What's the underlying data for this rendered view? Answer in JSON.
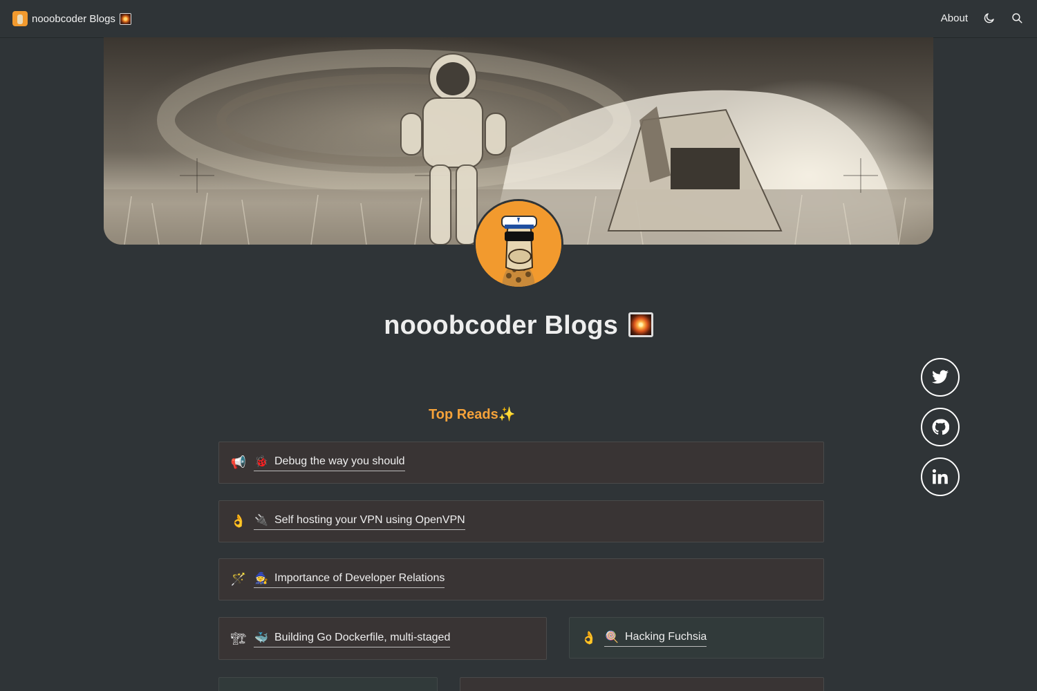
{
  "nav": {
    "brand_title": "nooobcoder Blogs",
    "about_label": "About",
    "icons": [
      "moon-icon",
      "search-icon"
    ]
  },
  "page": {
    "title": "nooobcoder Blogs",
    "section_heading": "Top Reads",
    "sparkle": "✨"
  },
  "social": [
    "twitter-icon",
    "github-icon",
    "linkedin-icon"
  ],
  "cards": [
    {
      "lead_icon": "📢",
      "inline_icon": "🐞",
      "title": "Debug the way you should"
    },
    {
      "lead_icon": "👌",
      "inline_icon": "🔌",
      "title": "Self hosting your VPN using OpenVPN"
    },
    {
      "lead_icon": "🪄",
      "inline_icon": "🧙",
      "title": "Importance of Developer Relations"
    },
    {
      "lead_icon": "🏗",
      "inline_icon": "🐳",
      "title": "Building Go Dockerfile, multi-staged"
    },
    {
      "lead_icon": "👌",
      "inline_icon": "🍭",
      "title": "Hacking Fuchsia"
    }
  ],
  "colors": {
    "background": "#2f3437",
    "accent": "#f5a23a",
    "card": "#393434",
    "card_alt": "#313a3a"
  }
}
